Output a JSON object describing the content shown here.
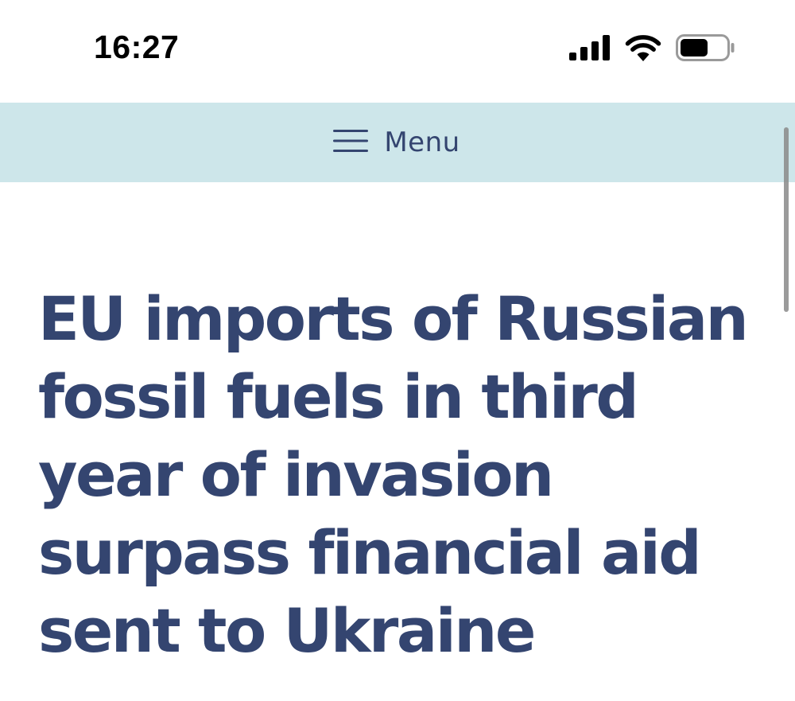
{
  "status_bar": {
    "time": "16:27",
    "icons": [
      "cellular-signal-icon",
      "wifi-icon",
      "battery-icon"
    ]
  },
  "nav": {
    "menu_label": "Menu",
    "menu_icon": "hamburger-icon"
  },
  "article": {
    "title": "EU imports of Russian fossil fuels in third year of invasion surpass financial aid sent to Ukraine"
  },
  "colors": {
    "menu_bar_bg": "#cde6ea",
    "brand_text": "#344570",
    "status_text": "#000000"
  }
}
